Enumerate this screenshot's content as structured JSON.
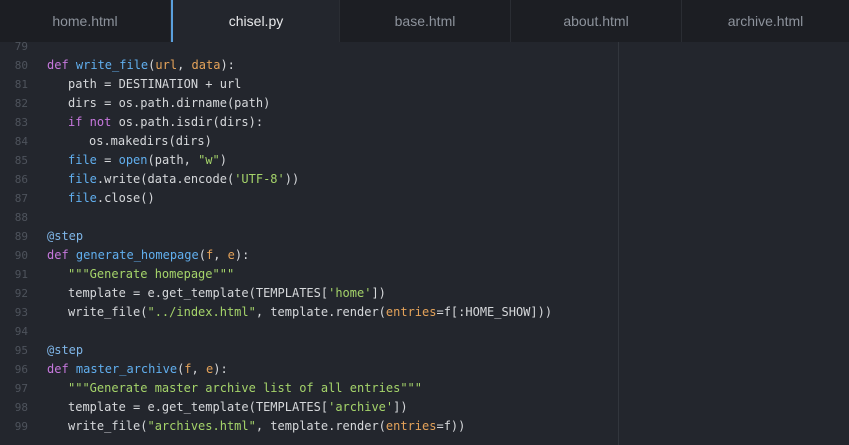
{
  "tabs": [
    {
      "label": "home.html"
    },
    {
      "label": "chisel.py"
    },
    {
      "label": "base.html"
    },
    {
      "label": "about.html"
    },
    {
      "label": "archive.html"
    }
  ],
  "active_tab": "chisel.py",
  "lines": [
    {
      "num": "79",
      "indent": 0,
      "tokens": []
    },
    {
      "num": "80",
      "indent": 0,
      "tokens": [
        [
          "kw",
          "def "
        ],
        [
          "fn",
          "write_file"
        ],
        [
          "p",
          "("
        ],
        [
          "pm",
          "url"
        ],
        [
          "p",
          ", "
        ],
        [
          "pm",
          "data"
        ],
        [
          "p",
          "):"
        ]
      ]
    },
    {
      "num": "81",
      "indent": 1,
      "tokens": [
        [
          "p",
          "path = DESTINATION + url"
        ]
      ]
    },
    {
      "num": "82",
      "indent": 1,
      "tokens": [
        [
          "p",
          "dirs = os.path.dirname(path)"
        ]
      ]
    },
    {
      "num": "83",
      "indent": 1,
      "tokens": [
        [
          "kw",
          "if not "
        ],
        [
          "p",
          "os.path.isdir(dirs):"
        ]
      ]
    },
    {
      "num": "84",
      "indent": 2,
      "tokens": [
        [
          "p",
          "os.makedirs(dirs)"
        ]
      ]
    },
    {
      "num": "85",
      "indent": 1,
      "tokens": [
        [
          "fn",
          "file"
        ],
        [
          "p",
          " = "
        ],
        [
          "fn",
          "open"
        ],
        [
          "p",
          "(path, "
        ],
        [
          "st",
          "\"w\""
        ],
        [
          "p",
          ")"
        ]
      ]
    },
    {
      "num": "86",
      "indent": 1,
      "tokens": [
        [
          "fn",
          "file"
        ],
        [
          "p",
          ".write(data.encode("
        ],
        [
          "st",
          "'UTF-8'"
        ],
        [
          "p",
          "))"
        ]
      ]
    },
    {
      "num": "87",
      "indent": 1,
      "tokens": [
        [
          "fn",
          "file"
        ],
        [
          "p",
          ".close()"
        ]
      ]
    },
    {
      "num": "88",
      "indent": 0,
      "tokens": []
    },
    {
      "num": "89",
      "indent": 0,
      "tokens": [
        [
          "dc",
          "@step"
        ]
      ]
    },
    {
      "num": "90",
      "indent": 0,
      "tokens": [
        [
          "kw",
          "def "
        ],
        [
          "fn",
          "generate_homepage"
        ],
        [
          "p",
          "("
        ],
        [
          "pm",
          "f"
        ],
        [
          "p",
          ", "
        ],
        [
          "pm",
          "e"
        ],
        [
          "p",
          "):"
        ]
      ]
    },
    {
      "num": "91",
      "indent": 1,
      "tokens": [
        [
          "st",
          "\"\"\"Generate homepage\"\"\""
        ]
      ]
    },
    {
      "num": "92",
      "indent": 1,
      "tokens": [
        [
          "p",
          "template = e.get_template(TEMPLATES["
        ],
        [
          "st",
          "'home'"
        ],
        [
          "p",
          "])"
        ]
      ]
    },
    {
      "num": "93",
      "indent": 1,
      "tokens": [
        [
          "p",
          "write_file("
        ],
        [
          "st",
          "\"../index.html\""
        ],
        [
          "p",
          ", template.render("
        ],
        [
          "pm",
          "entries"
        ],
        [
          "p",
          "=f[:HOME_SHOW]))"
        ]
      ]
    },
    {
      "num": "94",
      "indent": 0,
      "tokens": []
    },
    {
      "num": "95",
      "indent": 0,
      "tokens": [
        [
          "dc",
          "@step"
        ]
      ]
    },
    {
      "num": "96",
      "indent": 0,
      "tokens": [
        [
          "kw",
          "def "
        ],
        [
          "fn",
          "master_archive"
        ],
        [
          "p",
          "("
        ],
        [
          "pm",
          "f"
        ],
        [
          "p",
          ", "
        ],
        [
          "pm",
          "e"
        ],
        [
          "p",
          "):"
        ]
      ]
    },
    {
      "num": "97",
      "indent": 1,
      "tokens": [
        [
          "st",
          "\"\"\"Generate master archive list of all entries\"\"\""
        ]
      ]
    },
    {
      "num": "98",
      "indent": 1,
      "tokens": [
        [
          "p",
          "template = e.get_template(TEMPLATES["
        ],
        [
          "st",
          "'archive'"
        ],
        [
          "p",
          "])"
        ]
      ]
    },
    {
      "num": "99",
      "indent": 1,
      "tokens": [
        [
          "p",
          "write_file("
        ],
        [
          "st",
          "\"archives.html\""
        ],
        [
          "p",
          ", template.render("
        ],
        [
          "pm",
          "entries"
        ],
        [
          "p",
          "=f))"
        ]
      ]
    }
  ]
}
